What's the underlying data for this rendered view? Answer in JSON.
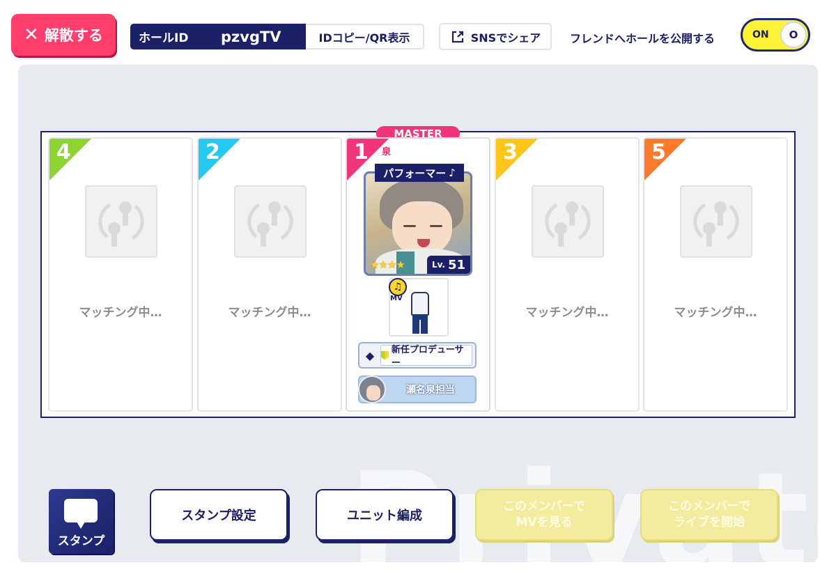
{
  "top_bar": {
    "disband_label": "解散する",
    "hall_id_label": "ホールID",
    "hall_id_value": "pzvgTV",
    "id_copy_label": "IDコピー/QR表示",
    "sns_share_label": "SNSでシェア",
    "publish_label": "フレンドへホールを公開する",
    "toggle_state": "ON"
  },
  "room": {
    "master_badge": "MASTER",
    "watermark": "Private",
    "slots": [
      {
        "number": "4",
        "status": "マッチング中…",
        "color": "#8ed334"
      },
      {
        "number": "2",
        "status": "マッチング中…",
        "color": "#25c8ee"
      },
      {
        "number": "1",
        "color": "#f0357a"
      },
      {
        "number": "3",
        "status": "マッチング中…",
        "color": "#ffc61a"
      },
      {
        "number": "5",
        "status": "マッチング中…",
        "color": "#ff7a2a"
      }
    ],
    "player": {
      "character_name": "泉",
      "role": "パフォーマー",
      "stars": "★★★★",
      "level_label": "Lv.",
      "level": "51",
      "mv_badge": "MV",
      "title": "新任プロデューサー",
      "fan_label": "瀬名泉担当"
    }
  },
  "bottom": {
    "stamp_label": "スタンプ",
    "stamp_settings_label": "スタンプ設定",
    "unit_formation_label": "ユニット編成",
    "watch_mv_label": "このメンバーで\nMVを見る",
    "start_live_label": "このメンバーで\nライブを開始"
  },
  "colors": {
    "navy": "#1c2066",
    "pink": "#ff3e6c",
    "toggle": "#fff338",
    "panel": "#e7ebef"
  },
  "icons": [
    "close-icon",
    "share-icon",
    "matching-icon",
    "note-icon",
    "leaf-icon",
    "speech-bubble-icon"
  ]
}
